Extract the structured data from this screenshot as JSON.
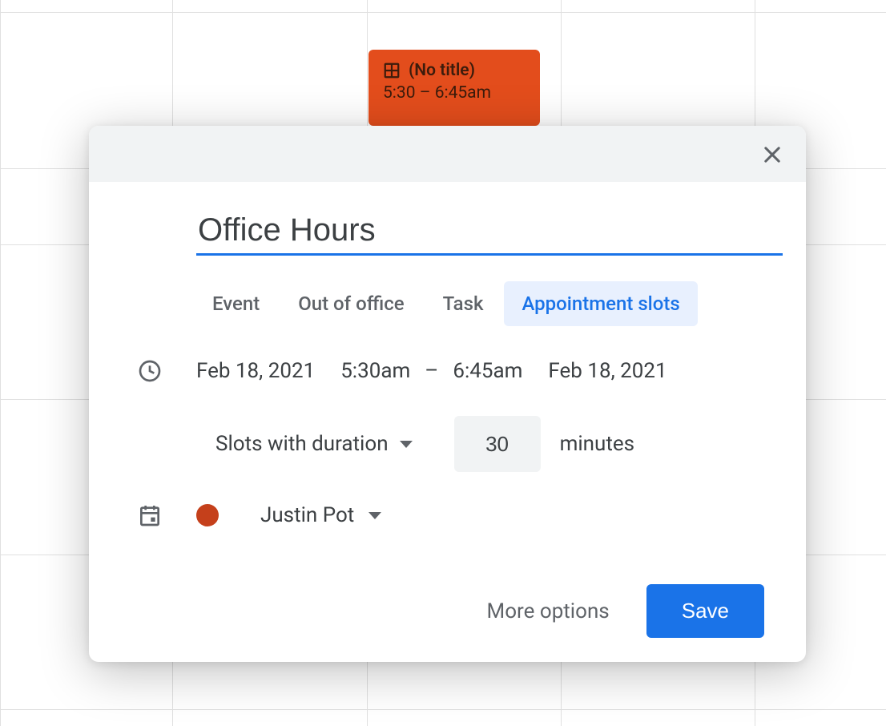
{
  "event_block": {
    "title": "(No title)",
    "time": "5:30 – 6:45am"
  },
  "dialog": {
    "title": "Office Hours",
    "tabs": {
      "event": "Event",
      "out_of_office": "Out of office",
      "task": "Task",
      "appointment_slots": "Appointment slots"
    },
    "time": {
      "start_date": "Feb 18, 2021",
      "start_time": "5:30am",
      "dash": "–",
      "end_time": "6:45am",
      "end_date": "Feb 18, 2021"
    },
    "duration": {
      "label": "Slots with duration",
      "value": "30",
      "unit": "minutes"
    },
    "calendar": {
      "color": "#c5401b",
      "name": "Justin Pot"
    },
    "footer": {
      "more_options": "More options",
      "save": "Save"
    }
  }
}
